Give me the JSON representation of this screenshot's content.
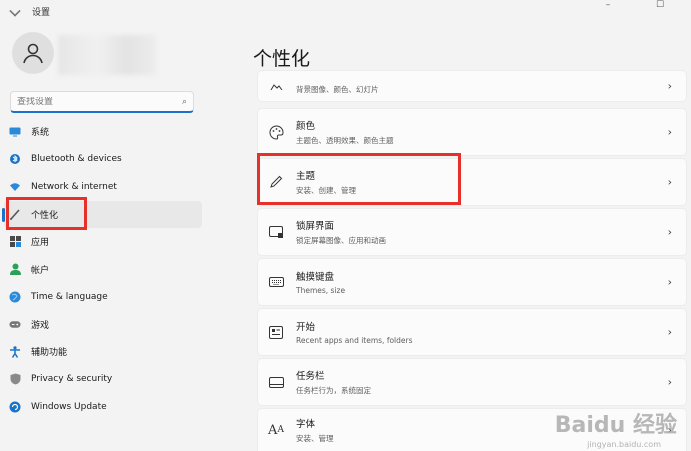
{
  "window": {
    "title": "设置",
    "controls": [
      "–",
      "☐"
    ]
  },
  "search": {
    "placeholder": "查找设置",
    "value": ""
  },
  "nav": {
    "items": [
      {
        "label": "系统",
        "icon": "monitor-icon"
      },
      {
        "label": "Bluetooth & devices",
        "icon": "bluetooth-icon"
      },
      {
        "label": "Network & internet",
        "icon": "wifi-icon"
      },
      {
        "label": "个性化",
        "icon": "brush-icon",
        "selected": true
      },
      {
        "label": "应用",
        "icon": "apps-icon"
      },
      {
        "label": "帐户",
        "icon": "account-icon"
      },
      {
        "label": "Time & language",
        "icon": "globe-icon"
      },
      {
        "label": "游戏",
        "icon": "gamepad-icon"
      },
      {
        "label": "辅助功能",
        "icon": "accessibility-icon"
      },
      {
        "label": "Privacy & security",
        "icon": "shield-icon"
      },
      {
        "label": "Windows Update",
        "icon": "update-icon"
      }
    ]
  },
  "main": {
    "title": "个性化",
    "cards": [
      {
        "title": "",
        "subtitle": "背景图像、颜色、幻灯片",
        "icon": "image-icon"
      },
      {
        "title": "颜色",
        "subtitle": "主题色、透明效果、颜色主题",
        "icon": "palette-icon"
      },
      {
        "title": "主题",
        "subtitle": "安装、创建、管理",
        "icon": "pen-icon"
      },
      {
        "title": "锁屏界面",
        "subtitle": "锁定屏幕图像、应用和动画",
        "icon": "lockscreen-icon"
      },
      {
        "title": "触摸键盘",
        "subtitle": "Themes, size",
        "icon": "keyboard-icon"
      },
      {
        "title": "开始",
        "subtitle": "Recent apps and items, folders",
        "icon": "start-icon"
      },
      {
        "title": "任务栏",
        "subtitle": "任务栏行为，系统固定",
        "icon": "taskbar-icon"
      },
      {
        "title": "字体",
        "subtitle": "安装、管理",
        "icon": "font-icon"
      }
    ]
  },
  "watermark": {
    "brand": "Baidu 经验",
    "url": "jingyan.baidu.com"
  },
  "colors": {
    "accent": "#1a73c8",
    "highlight": "#e8302a",
    "background": "#f3f3f3",
    "card": "#fbfbfb"
  }
}
